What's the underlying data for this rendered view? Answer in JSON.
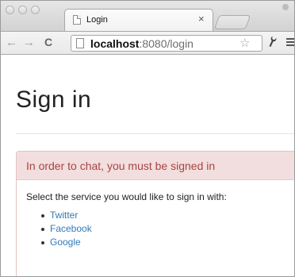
{
  "browser": {
    "tab_title": "Login",
    "tab_close": "×",
    "url_host": "localhost",
    "url_rest": ":8080/login",
    "back_glyph": "←",
    "forward_glyph": "→",
    "reload_glyph": "C",
    "star_glyph": "☆",
    "wrench_glyph": "🔧"
  },
  "page": {
    "title": "Sign in",
    "alert": "In order to chat, you must be signed in",
    "instructions": "Select the service you would like to sign in with:",
    "services": [
      "Twitter",
      "Facebook",
      "Google"
    ]
  }
}
